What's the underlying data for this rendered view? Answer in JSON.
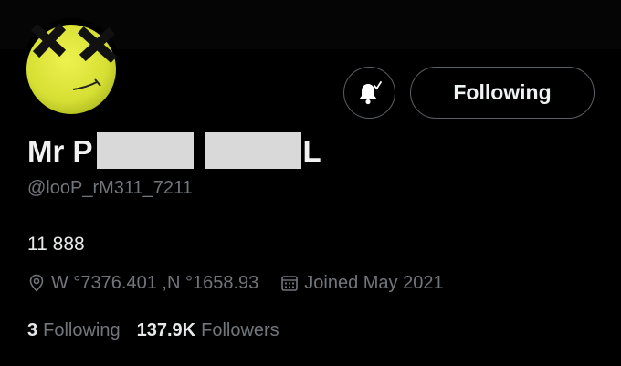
{
  "profile": {
    "name_start": "Mr P",
    "name_end": "L",
    "handle": "@looP_rM311_7211",
    "bio": "11 888",
    "location": "W °7376.401 ,N °1658.93",
    "joined": "Joined May 2021"
  },
  "actions": {
    "follow_label": "Following"
  },
  "stats": {
    "following_count": "3",
    "following_label": "Following",
    "followers_count": "137.9K",
    "followers_label": "Followers"
  },
  "colors": {
    "background": "#000000",
    "avatar_yellow": "#d8e23a",
    "muted_text": "#71767b",
    "redaction": "#d9d9d9"
  }
}
